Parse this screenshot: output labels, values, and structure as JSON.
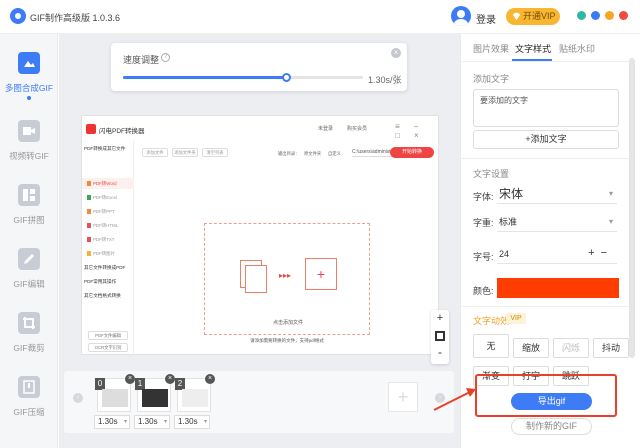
{
  "app": {
    "title": "GIF制作高级版 1.0.3.6",
    "login": "登录",
    "vip_button": "开通VIP"
  },
  "sidebar": {
    "items": [
      {
        "label": "多图合成GIF",
        "icon": "image-stack-icon",
        "active": true
      },
      {
        "label": "视频转GIF",
        "icon": "video-icon"
      },
      {
        "label": "GIF拼图",
        "icon": "collage-icon"
      },
      {
        "label": "GIF编辑",
        "icon": "edit-pen-icon"
      },
      {
        "label": "GIF裁剪",
        "icon": "crop-icon"
      },
      {
        "label": "GIF压缩",
        "icon": "compress-icon"
      }
    ]
  },
  "speed": {
    "title": "速度调整",
    "value": "1.30s/张",
    "level": 0.68
  },
  "preview": {
    "title": "闪电PDF转换器",
    "user": "未登录",
    "member": "购买会员",
    "categories": [
      {
        "label": "PDF转换成其它文件"
      },
      {
        "label": "其它文件转换成PDF"
      },
      {
        "label": "PDF常用其操作"
      },
      {
        "label": "其它文档格式转换"
      }
    ],
    "subitems": [
      "PDF转Word",
      "PDF转Excel",
      "PDF转PPT",
      "PDF转HTML",
      "PDF转TXT",
      "PDF转图片"
    ],
    "tools": [
      "添加文件",
      "添加文件夹",
      "清空列表"
    ],
    "output_label": "输出目录：",
    "radio_original": "原文件夹",
    "radio_custom": "自定义",
    "path": "C:\\users\\administ",
    "start": "开始转换",
    "drop_text": "点击添加文件",
    "hint": "请添加需要转换的文件，支持pdf格式",
    "side_buttons": [
      "PDF文件编辑",
      "OCR文字识别"
    ]
  },
  "frames": [
    {
      "index": "0",
      "time": "1.30s"
    },
    {
      "index": "1",
      "time": "1.30s"
    },
    {
      "index": "2",
      "time": "1.30s"
    }
  ],
  "right_panel": {
    "tabs": [
      "图片效果",
      "文字样式",
      "贴纸水印"
    ],
    "active_tab": "文字样式",
    "add_text_section": "添加文字",
    "text_placeholder": "要添加的文字",
    "add_text_button": "+添加文字",
    "text_settings": "文字设置",
    "font_label": "字体:",
    "font_value": "宋体",
    "weight_label": "字重:",
    "weight_value": "标准",
    "size_label": "字号:",
    "size_value": "24",
    "color_label": "颜色:",
    "color_value": "#ff3d00",
    "fx_title": "文字动效",
    "vip_tag": "VIP",
    "fx_buttons": [
      "无",
      "缩放",
      "闪烁",
      "抖动",
      "渐变",
      "打字",
      "跳跃"
    ],
    "export_button": "导出gif",
    "make_new_button": "制作新的GIF"
  },
  "colors": {
    "accent": "#3d7cf5",
    "vip": "#f7b733",
    "highlight": "#e8412a",
    "text_color": "#ff3d00"
  }
}
